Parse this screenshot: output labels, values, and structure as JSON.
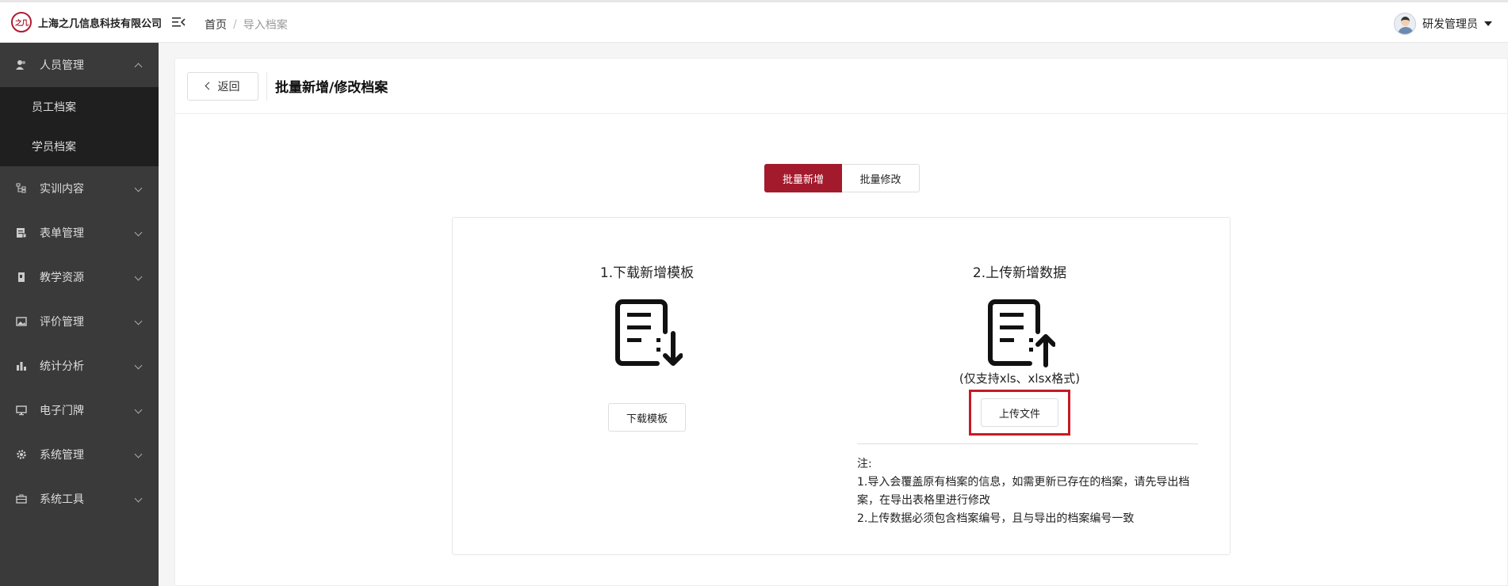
{
  "header": {
    "logo_mark": "之几",
    "company_name": "上海之几信息科技有限公司",
    "breadcrumb": {
      "home": "首页",
      "separator": "/",
      "current": "导入档案"
    },
    "user_name": "研发管理员"
  },
  "sidebar": {
    "items": [
      {
        "label": "人员管理",
        "icon": "users-icon",
        "expanded": true,
        "children": [
          {
            "label": "员工档案"
          },
          {
            "label": "学员档案"
          }
        ]
      },
      {
        "label": "实训内容",
        "icon": "tree-icon"
      },
      {
        "label": "表单管理",
        "icon": "form-icon"
      },
      {
        "label": "教学资源",
        "icon": "book-icon"
      },
      {
        "label": "评价管理",
        "icon": "image-icon"
      },
      {
        "label": "统计分析",
        "icon": "bar-chart-icon"
      },
      {
        "label": "电子门牌",
        "icon": "monitor-icon"
      },
      {
        "label": "系统管理",
        "icon": "gear-icon"
      },
      {
        "label": "系统工具",
        "icon": "toolbox-icon"
      }
    ]
  },
  "page": {
    "back_label": "返回",
    "title": "批量新增/修改档案",
    "tabs": [
      {
        "label": "批量新增",
        "active": true
      },
      {
        "label": "批量修改",
        "active": false
      }
    ],
    "download": {
      "title": "1.下载新增模板",
      "button": "下载模板"
    },
    "upload": {
      "title": "2.上传新增数据",
      "support": "(仅支持xls、xlsx格式)",
      "button": "上传文件"
    },
    "note": {
      "heading": "注:",
      "line1": "1.导入会覆盖原有档案的信息，如需更新已存在的档案，请先导出档案，在导出表格里进行修改",
      "line2": "2.上传数据必须包含档案编号，且与导出的档案编号一致"
    }
  },
  "colors": {
    "accent": "#a31a2d",
    "sidebar_bg": "#3a3a3a",
    "highlight_box": "#c61a25"
  }
}
